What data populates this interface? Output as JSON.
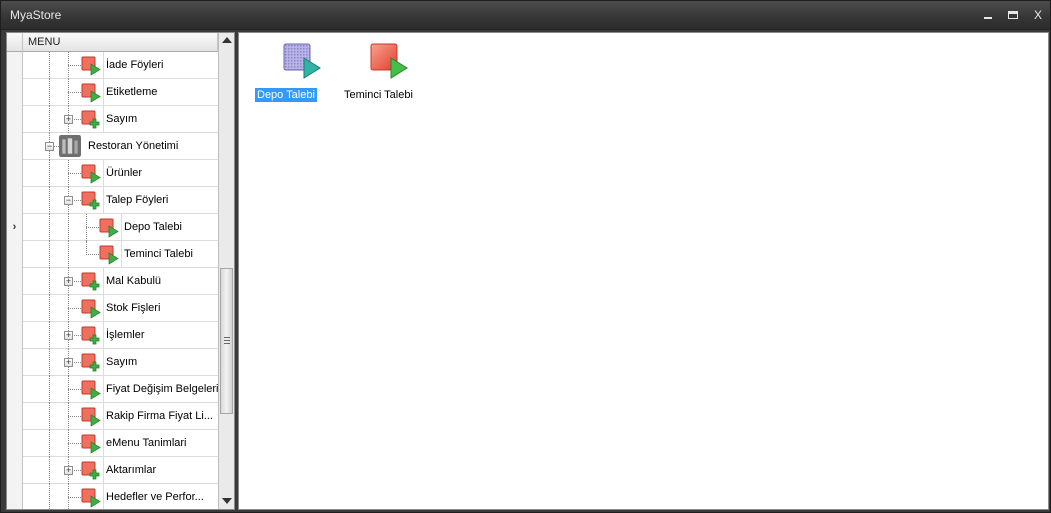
{
  "window": {
    "title": "MyaStore",
    "controls": {
      "minimize": "minimize-icon",
      "maximize": "maximize-icon",
      "close": "X"
    }
  },
  "tree": {
    "header": "MENU",
    "current_row_marker": "›",
    "items": [
      {
        "label": "İade Föyleri",
        "icon": "play-form-icon",
        "expandable": false
      },
      {
        "label": "Etiketleme",
        "icon": "play-form-icon",
        "expandable": false
      },
      {
        "label": "Sayım",
        "icon": "add-form-icon",
        "expandable": true,
        "expanded": false
      },
      {
        "label": "Restoran Yönetimi",
        "icon": "restaurant-photo-icon",
        "expandable": true,
        "expanded": true
      },
      {
        "label": "Ürünler",
        "icon": "play-form-icon",
        "expandable": false
      },
      {
        "label": "Talep Föyleri",
        "icon": "add-form-icon",
        "expandable": true,
        "expanded": true
      },
      {
        "label": "Depo Talebi",
        "icon": "play-form-icon",
        "expandable": false,
        "current": true
      },
      {
        "label": "Teminci Talebi",
        "icon": "play-form-icon",
        "expandable": false
      },
      {
        "label": "Mal Kabulü",
        "icon": "add-form-icon",
        "expandable": true,
        "expanded": false
      },
      {
        "label": "Stok Fişleri",
        "icon": "play-form-icon",
        "expandable": false
      },
      {
        "label": "İşlemler",
        "icon": "add-form-icon",
        "expandable": true,
        "expanded": false
      },
      {
        "label": "Sayım",
        "icon": "add-form-icon",
        "expandable": true,
        "expanded": false
      },
      {
        "label": "Fiyat Değişim Belgeleri",
        "icon": "play-form-icon",
        "expandable": false
      },
      {
        "label": "Rakip Firma Fiyat Li...",
        "icon": "play-form-icon",
        "expandable": false
      },
      {
        "label": "eMenu Tanimlari",
        "icon": "play-form-icon",
        "expandable": false
      },
      {
        "label": "Aktarımlar",
        "icon": "add-form-icon",
        "expandable": true,
        "expanded": false
      },
      {
        "label": "Hedefler ve Perfor...",
        "icon": "play-form-icon",
        "expandable": false
      }
    ]
  },
  "content": {
    "tiles": [
      {
        "label": "Depo Talebi",
        "icon": "depot-request-icon",
        "selected": true
      },
      {
        "label": "Teminci Talebi",
        "icon": "supplier-request-icon",
        "selected": false
      }
    ]
  },
  "colors": {
    "selection": "#3399ff",
    "icon_red": "#e8463a",
    "icon_green": "#3cb043",
    "titlebar": "#3c3c3c"
  }
}
